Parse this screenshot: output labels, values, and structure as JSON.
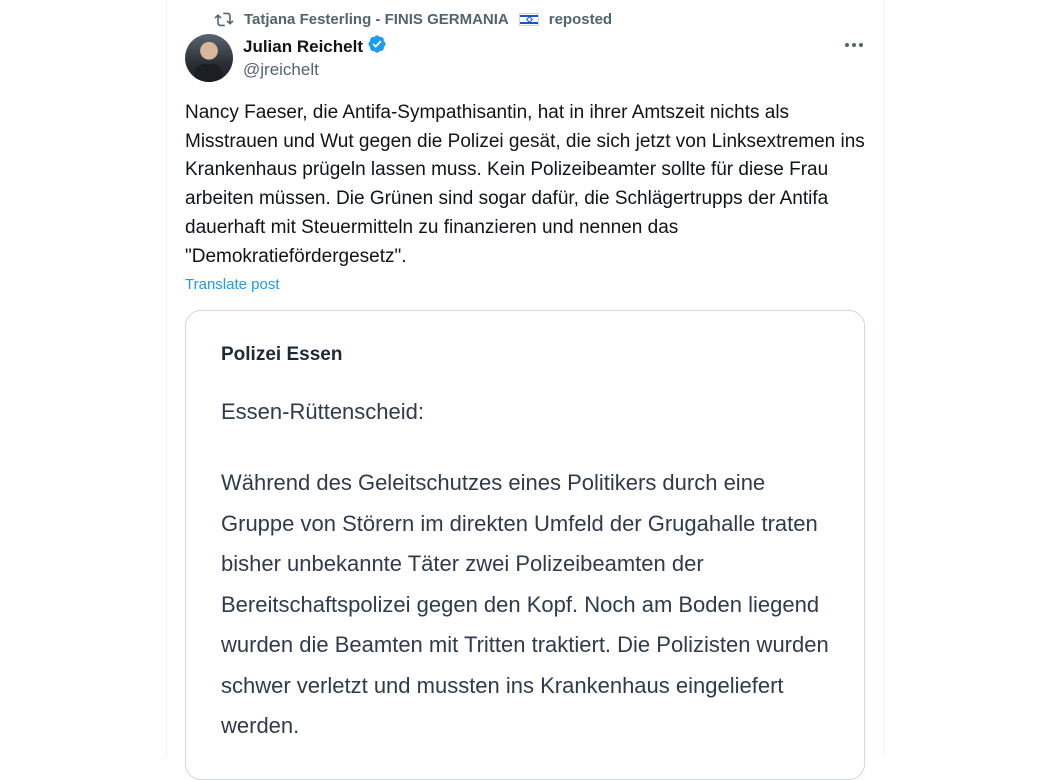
{
  "repost": {
    "reposter": "Tatjana Festerling - FINIS GERMANIA",
    "flag_icon": "israel-flag-icon",
    "label": "reposted"
  },
  "author": {
    "name": "Julian Reichelt",
    "handle": "@jreichelt",
    "verified_color": "#1d9bf0"
  },
  "post": {
    "text": "Nancy Faeser, die Antifa-Sympathisantin, hat in ihrer Amtszeit nichts als Misstrauen und Wut gegen die Polizei gesät, die sich jetzt von Linksextremen ins Krankenhaus prügeln lassen muss. Kein Polizeibeamter sollte für diese Frau arbeiten müssen. Die Grünen sind sogar dafür, die Schlägertrupps der Antifa dauerhaft mit Steuermitteln zu finanzieren und nennen das \"Demokratiefördergesetz\".",
    "translate_label": "Translate post"
  },
  "embedded": {
    "author": "Polizei Essen",
    "location": "Essen-Rüttenscheid:",
    "body": "Während des Geleitschutzes eines Politikers durch eine Gruppe von Störern im direkten Umfeld der Grugahalle traten bisher unbekannte Täter zwei Polizeibeamten der Bereitschaftspolizei gegen den Kopf. Noch am Boden liegend wurden die Beamten mit Tritten traktiert. Die Polizisten wurden schwer verletzt und mussten ins Krankenhaus eingeliefert werden."
  },
  "colors": {
    "link": "#1d9bf0",
    "secondary_text": "#536471",
    "border": "#cfd9de"
  }
}
